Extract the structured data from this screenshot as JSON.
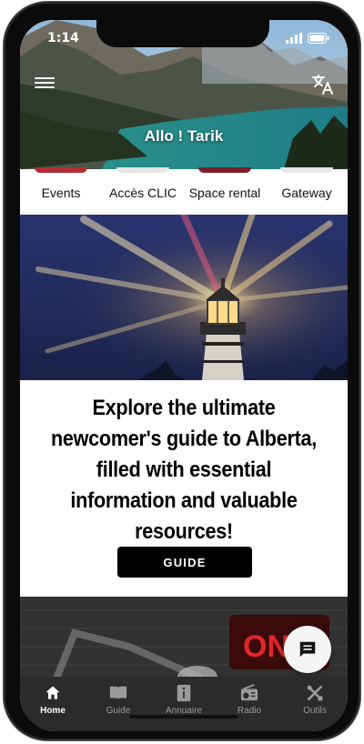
{
  "status_bar": {
    "time": "1:14"
  },
  "header": {
    "title": "Allo ! Tarik"
  },
  "top_nav": {
    "items": [
      {
        "label": "Events",
        "color": "#b32d34"
      },
      {
        "label": "Accès CLIC",
        "color": "#ffffff"
      },
      {
        "label": "Space rental",
        "color": "#7a1f2a"
      },
      {
        "label": "Gateway",
        "color": "#ffffff"
      }
    ]
  },
  "promo": {
    "text": "Explore the ultimate newcomer's guide to Alberta, filled with essential information and valuable resources!",
    "button_label": "GUIDE"
  },
  "tab_bar": {
    "items": [
      {
        "label": "Home",
        "icon": "home-icon",
        "active": true
      },
      {
        "label": "Guide",
        "icon": "book-icon",
        "active": false
      },
      {
        "label": "Annuaire",
        "icon": "directory-icon",
        "active": false
      },
      {
        "label": "Radio",
        "icon": "radio-icon",
        "active": false
      },
      {
        "label": "Outils",
        "icon": "tools-icon",
        "active": false
      }
    ]
  },
  "colors": {
    "tab_bar_bg": "#2b2b2b",
    "button_bg": "#000000",
    "active_tab": "#ffffff",
    "inactive_tab": "#9a9a9a"
  }
}
